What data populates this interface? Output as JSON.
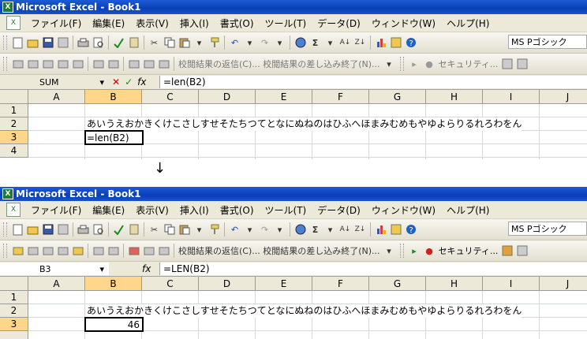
{
  "before": {
    "title": "Microsoft Excel - Book1",
    "menus": [
      "ファイル(F)",
      "編集(E)",
      "表示(V)",
      "挿入(I)",
      "書式(O)",
      "ツール(T)",
      "データ(D)",
      "ウィンドウ(W)",
      "ヘルプ(H)"
    ],
    "font_name": "MS Pゴシック",
    "review_text": "校閲結果の返信(C)... 校閲結果の差し込み終了(N)...",
    "security_label": "セキュリティ...",
    "name_box": "SUM",
    "formula": "=len(B2)",
    "columns": [
      "A",
      "B",
      "C",
      "D",
      "E",
      "F",
      "G",
      "H",
      "I",
      "J"
    ],
    "rows": [
      "1",
      "2",
      "3",
      "4"
    ],
    "b2_text": "あいうえおかきくけこさしすせそたちつてとなにぬねのはひふへほまみむめもやゆよらりるれろわをん",
    "b3_text": "=len(B2)"
  },
  "after": {
    "title": "Microsoft Excel - Book1",
    "menus": [
      "ファイル(F)",
      "編集(E)",
      "表示(V)",
      "挿入(I)",
      "書式(O)",
      "ツール(T)",
      "データ(D)",
      "ウィンドウ(W)",
      "ヘルプ(H)"
    ],
    "font_name": "MS Pゴシック",
    "review_text": "校閲結果の返信(C)... 校閲結果の差し込み終了(N)...",
    "security_label": "セキュリティ...",
    "name_box": "B3",
    "formula": "=LEN(B2)",
    "columns": [
      "A",
      "B",
      "C",
      "D",
      "E",
      "F",
      "G",
      "H",
      "I",
      "J"
    ],
    "rows": [
      "1",
      "2",
      "3"
    ],
    "b2_text": "あいうえおかきくけこさしすせそたちつてとなにぬねのはひふへほまみむめもやゆよらりるれろわをん",
    "b3_value": "46"
  },
  "arrow": "↓",
  "icons": [
    "new-icon",
    "open-icon",
    "save-icon",
    "permission-icon",
    "print-icon",
    "print-preview-icon",
    "spelling-icon",
    "research-icon",
    "cut-icon",
    "copy-icon",
    "paste-icon",
    "format-painter-icon",
    "undo-icon",
    "redo-icon",
    "hyperlink-icon",
    "autosum-icon",
    "sort-ascending-icon",
    "sort-descending-icon",
    "chart-icon",
    "drawing-icon",
    "help-icon"
  ],
  "colors": {
    "title_bar": "#0a3fb5",
    "selected_header": "#ffd68a",
    "chrome": "#ece9d8"
  }
}
